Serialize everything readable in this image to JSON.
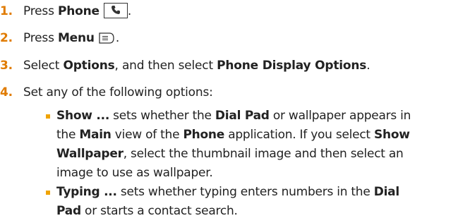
{
  "steps": [
    {
      "number": "1.",
      "pre": "Press ",
      "bold": "Phone",
      "post": ".",
      "key_icon": "phone-key-icon"
    },
    {
      "number": "2.",
      "pre": "Press ",
      "bold": "Menu",
      "post": ".",
      "key_icon": "menu-key-icon"
    },
    {
      "number": "3.",
      "pre": "Select ",
      "bold": "Options",
      "mid": ", and then select ",
      "bold2": "Phone Display Options",
      "post": "."
    },
    {
      "number": "4.",
      "text": "Set any of the following options:"
    }
  ],
  "bullets": [
    {
      "lines": [
        {
          "b1": "Show ...",
          "t1": " sets whether the ",
          "b2": "Dial Pad",
          "t2": " or wallpaper appears in"
        },
        {
          "t1": "the ",
          "b1": "Main",
          "t2": " view of the ",
          "b2": "Phone",
          "t3": " application. If you select ",
          "b3": "Show"
        },
        {
          "b1": "Wallpaper",
          "t1": ", select the thumbnail image and then select an"
        },
        {
          "t1": "image to use as wallpaper."
        }
      ]
    },
    {
      "lines": [
        {
          "b1": "Typing ...",
          "t1": " sets whether typing enters numbers in the ",
          "b2": "Dial"
        },
        {
          "b1": "Pad",
          "t1": " or starts a contact search."
        }
      ]
    }
  ],
  "colors": {
    "number": "#e07b00",
    "bullet": "#f0a400",
    "text": "#222222"
  }
}
